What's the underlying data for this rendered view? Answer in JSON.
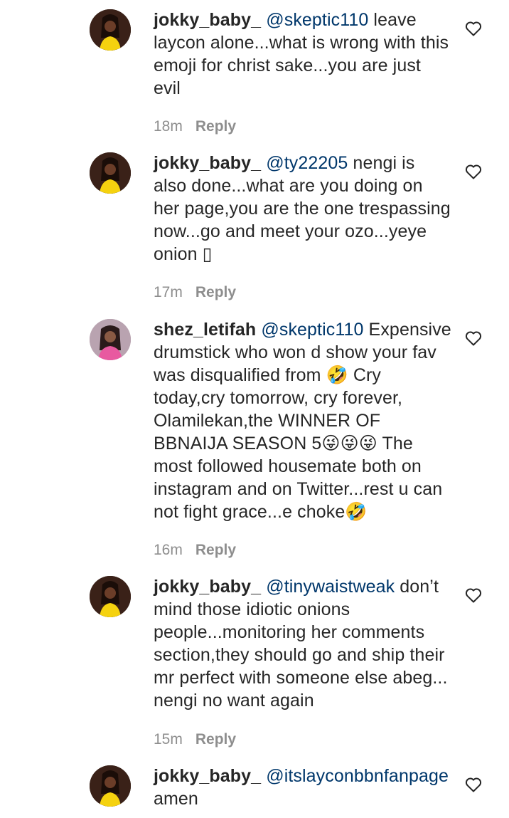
{
  "comments": [
    {
      "username": "jokky_baby_",
      "mention": "@skeptic110",
      "text": " leave laycon alone...what is wrong with this emoji for christ sake...you are just evil",
      "time": "18m",
      "reply_label": "Reply",
      "avatar": "woman-yellow-dress"
    },
    {
      "username": "jokky_baby_",
      "mention": "@ty22205",
      "text": " nengi is also done...what are you doing on her page,you are the one trespassing now...go and meet your ozo...yeye onion ▯",
      "time": "17m",
      "reply_label": "Reply",
      "avatar": "woman-yellow-dress"
    },
    {
      "username": "shez_letifah",
      "mention": "@skeptic110",
      "text": " Expensive drumstick who won d show your fav was disqualified from 🤣 Cry today,cry tomorrow, cry forever, Olamilekan,the WINNER OF BBNAIJA SEASON 5😜😜😜 The most followed housemate both on instagram and on Twitter...rest u can not fight grace...e choke🤣",
      "time": "16m",
      "reply_label": "Reply",
      "avatar": "woman-pink-outfit"
    },
    {
      "username": "jokky_baby_",
      "mention": "@tinywaistweak",
      "text": " don’t mind those idiotic onions people...monitoring her comments section,they should go and ship their mr perfect with someone else abeg... nengi no want again",
      "time": "15m",
      "reply_label": "Reply",
      "avatar": "woman-yellow-dress"
    },
    {
      "username": "jokky_baby_",
      "mention": "@itslayconbbnfanpage",
      "text": " amen",
      "avatar": "woman-yellow-dress"
    }
  ],
  "colors": {
    "text": "#262626",
    "mention": "#00376b",
    "meta": "#8e8e8e"
  },
  "icons": {
    "like": "heart-outline-icon"
  }
}
